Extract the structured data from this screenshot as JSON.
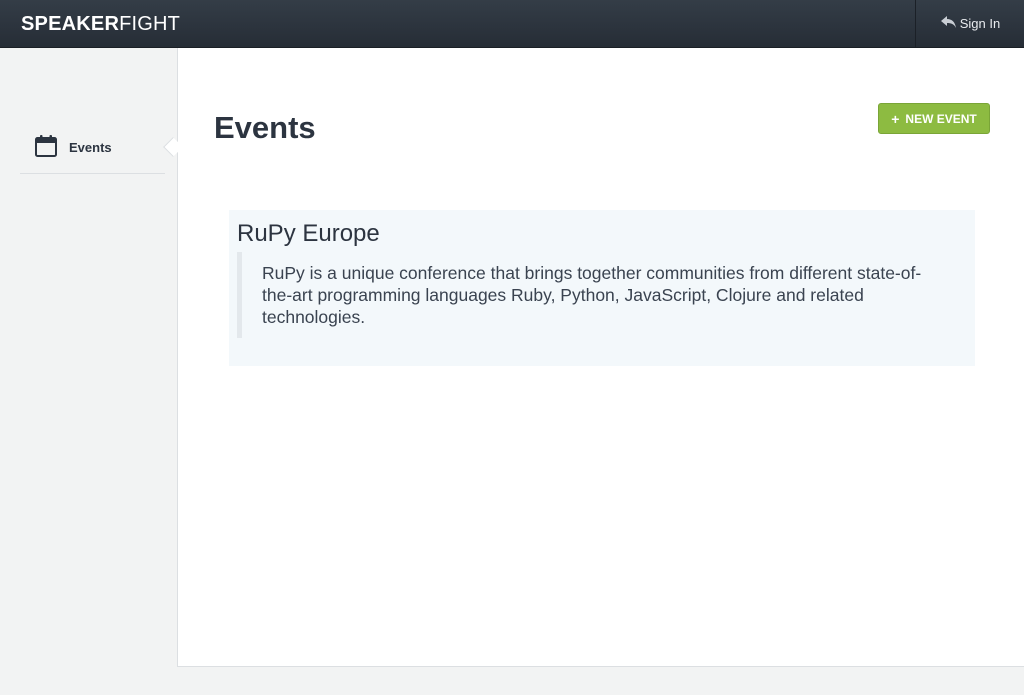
{
  "header": {
    "brand_bold": "SPEAKER",
    "brand_light": "FIGHT",
    "signin_label": "Sign In",
    "signin_icon": "reply-arrow-icon"
  },
  "sidebar": {
    "items": [
      {
        "label": "Events",
        "icon": "calendar-icon",
        "active": true
      }
    ]
  },
  "main": {
    "title": "Events",
    "new_event_label": "NEW EVENT",
    "new_event_icon": "+",
    "events": [
      {
        "name": "RuPy Europe",
        "description": "RuPy is a unique conference that brings together communities from different state-of-the-art programming languages Ruby, Python, JavaScript, Clojure and related technologies."
      }
    ]
  },
  "colors": {
    "topbar": "#2d353f",
    "accent_green": "#8dbb41",
    "card_bg": "#f3f8fb",
    "text": "#2c3440"
  }
}
